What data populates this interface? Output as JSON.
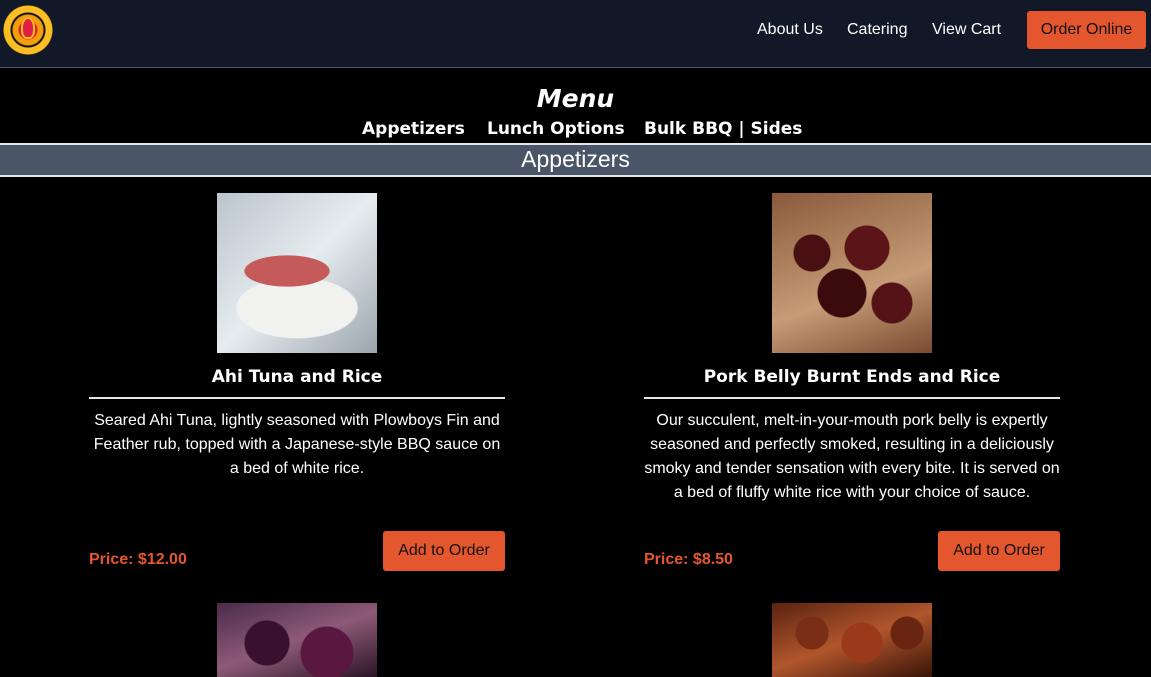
{
  "header": {
    "logo_name": "plowboys-bbq-logo",
    "nav": {
      "about": "About Us",
      "catering": "Catering",
      "cart": "View Cart"
    },
    "order_online": "Order Online"
  },
  "menu": {
    "title": "Menu",
    "categories": [
      "Appetizers",
      "Lunch Options",
      "Bulk BBQ | Sides"
    ]
  },
  "section": {
    "title": "Appetizers"
  },
  "items": [
    {
      "name": "Ahi Tuna and Rice",
      "description": "Seared Ahi Tuna, lightly seasoned with Plowboys Fin and Feather rub, topped with a Japanese-style BBQ sauce on a bed of white rice.",
      "price": "Price: $12.00",
      "button": "Add to Order"
    },
    {
      "name": "Pork Belly Burnt Ends and Rice",
      "description": "Our succulent, melt-in-your-mouth pork belly is expertly seasoned and perfectly smoked, resulting in a deliciously smoky and tender sensation with every bite. It is served on a bed of fluffy white rice with your choice of sauce.",
      "price": "Price: $8.50",
      "button": "Add to Order"
    }
  ],
  "colors": {
    "accent": "#e4572e",
    "header_bg": "#111827",
    "section_bg": "#4a5568"
  }
}
